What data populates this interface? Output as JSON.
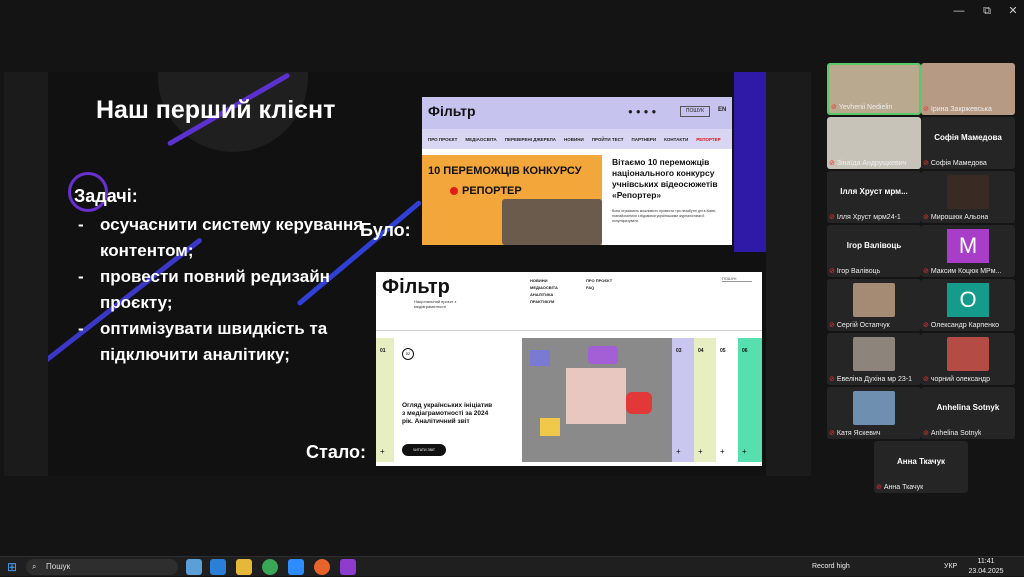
{
  "window": {
    "controls": {
      "minimize": "—",
      "restore": "⧉",
      "close": "✕"
    }
  },
  "slide": {
    "title": "Наш перший клієнт",
    "tasks_title": "Задачі:",
    "tasks": [
      "осучаснити систему керування контентом;",
      "провести повний редизайн проєкту;",
      "оптимізувати швидкість та підключити аналітику;"
    ],
    "label_was": "Було:",
    "label_now": "Стало:",
    "old_site": {
      "logo": "Фільтр",
      "search": "ПОШУК",
      "lang": "EN",
      "nav": [
        "ПРО ПРОЄКТ",
        "МЕДІАОСВІТА",
        "ПЕРЕВІРЕНІ ДЖЕРЕЛА",
        "НОВИНИ",
        "ПРОЙТИ ТЕСТ",
        "ПАРТНЕРИ",
        "КОНТАКТИ",
        "РЕПОРТЕР"
      ],
      "banner_title": "10 ПЕРЕМОЖЦІВ КОНКУРСУ",
      "banner_rep": "РЕПОРТЕР",
      "headline": "Вітаємо 10 переможців національного конкурсу учнівських відеосюжетів «Репортер»",
      "small": "Вони отримають можливість провести три незабутні дні в Києві, познайомитися з відомими українськими журналістами й популяризувати."
    },
    "new_site": {
      "logo": "Фільтр",
      "subtitle": "Національний проєкт з медіаграмотності",
      "menu_col1": [
        "НОВИНИ",
        "МЕДІАОСВІТА",
        "АНАЛІТИКА",
        "ПРАКТИКУМ"
      ],
      "menu_col2": [
        "ПРО ПРОЄКТ",
        "FAQ"
      ],
      "search": "ПОШУК",
      "strip_nums": [
        "01",
        "03",
        "04",
        "05",
        "06"
      ],
      "article_num": "02",
      "article_title": "Огляд українських ініціатив з медіаграмотності за 2024 рік. Аналітичний звіт",
      "read_btn": "ЧИТАТИ ЗВІТ",
      "plus": "+"
    }
  },
  "participants": [
    {
      "name": "Yevhenii Nedielin",
      "type": "photo",
      "color": "#b9a98f"
    },
    {
      "name": "Ірина Закржевська",
      "type": "photo",
      "color": "#b69a84"
    },
    {
      "name": "Зінаїда Андрущкевич",
      "type": "photo",
      "color": "#c7c3b8"
    },
    {
      "name": "Софія Мамедова",
      "type": "name",
      "big": "Софія Мамедова"
    },
    {
      "name": "Ілля Хруст мрм24-1",
      "type": "name",
      "big": "Ілля Хруст мрм..."
    },
    {
      "name": "Мирошюк Альона",
      "type": "pic",
      "color": "#3a2a24"
    },
    {
      "name": "Ігор Валівоць",
      "type": "name",
      "big": "Ігор Валівоць"
    },
    {
      "name": "Максим Коцюк МРм...",
      "type": "initial",
      "initial": "M",
      "color": "#a83ec7"
    },
    {
      "name": "Сергій Остапчук",
      "type": "pic",
      "color": "#a58a74"
    },
    {
      "name": "Олександр Карпенко",
      "type": "initial",
      "initial": "O",
      "color": "#159b8b"
    },
    {
      "name": "Евеліна Духіна мр 23-1",
      "type": "pic",
      "color": "#8d847c"
    },
    {
      "name": "чорний олександр",
      "type": "pic",
      "color": "#b44b45"
    },
    {
      "name": "Катя Яскевич",
      "type": "pic",
      "color": "#6e8fb0"
    },
    {
      "name": "Anhelina Sotnyk",
      "type": "name",
      "big": "Anhelina Sotnyk"
    },
    {
      "name": "Анна Ткачук",
      "type": "name",
      "big": "Анна Ткачук"
    }
  ],
  "taskbar": {
    "search_placeholder": "Пошук",
    "record": "Record high",
    "lang": "УКР",
    "time": "11:41",
    "date": "23.04.2025"
  }
}
